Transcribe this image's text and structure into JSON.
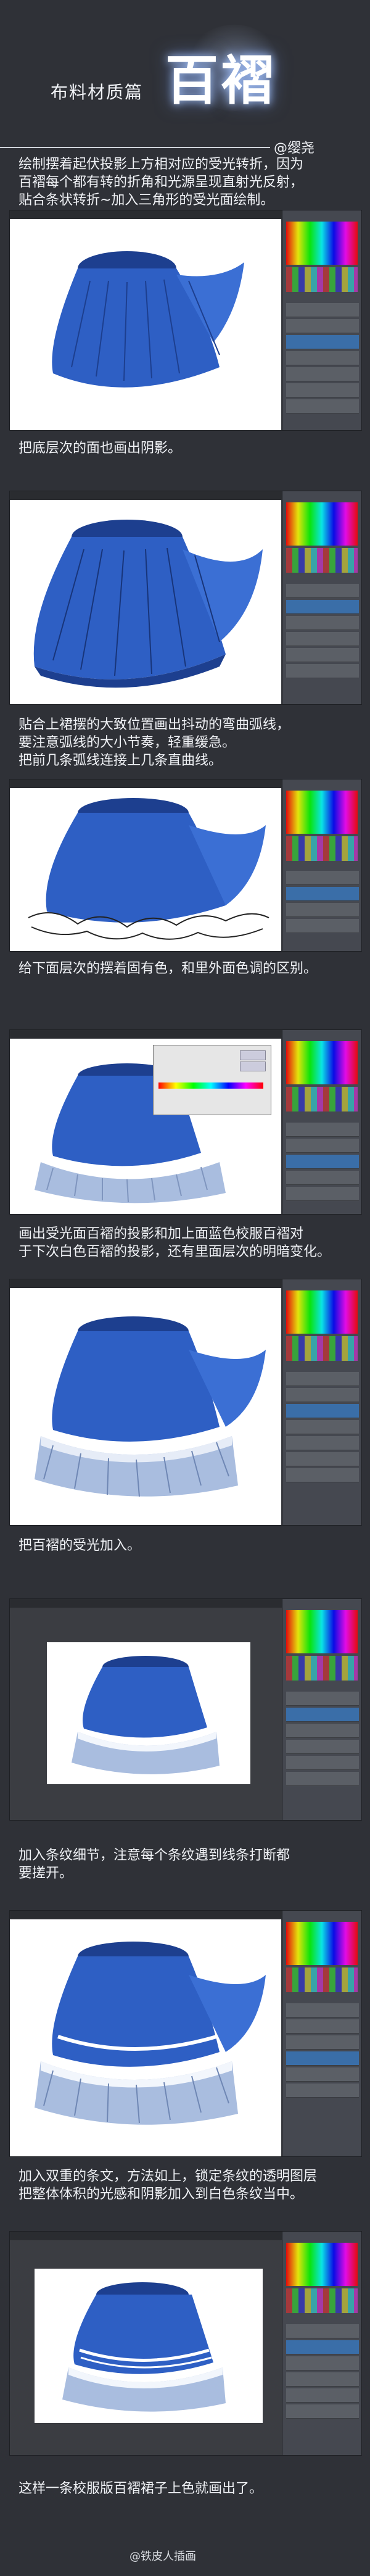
{
  "header": {
    "subtitle": "布料材质篇",
    "title": "百褶",
    "author": "@缨尧"
  },
  "steps": [
    {
      "lines": [
        "绘制摆着起伏投影上方相对应的受光转折，因为",
        "百褶每个都有转的折角和光源呈现直射光反射，",
        "贴合条状转折~加入三角形的受光面绘制。"
      ]
    },
    {
      "lines": [
        "把底层次的面也画出阴影。"
      ]
    },
    {
      "lines": [
        "贴合上裙摆的大致位置画出抖动的弯曲弧线，",
        "要注意弧线的大小节奏，轻重缓急。",
        "把前几条弧线连接上几条直曲线。"
      ]
    },
    {
      "lines": [
        "给下面层次的摆着固有色，和里外面色调的区别。"
      ]
    },
    {
      "lines": [
        "画出受光面百褶的投影和加上面蓝色校服百褶对",
        "于下次白色百褶的投影，还有里面层次的明暗变化。"
      ]
    },
    {
      "lines": [
        "把百褶的受光加入。"
      ]
    },
    {
      "lines": [
        "加入条纹细节，注意每个条纹遇到线条打断都",
        "要搓开。"
      ]
    },
    {
      "lines": [
        "加入双重的条文，方法如上，锁定条纹的透明图层",
        "把整体体积的光感和阴影加入到白色条纹当中。"
      ]
    },
    {
      "lines": [
        "这样一条校服版百褶裙子上色就画出了。"
      ]
    }
  ],
  "watermark": "@铁皮人插画",
  "colors": {
    "page_bg": "#2f3137",
    "skirt_blue": "#2e5fc4",
    "skirt_blue_dark": "#1d3f8f",
    "underlayer": "#a9bddf"
  }
}
